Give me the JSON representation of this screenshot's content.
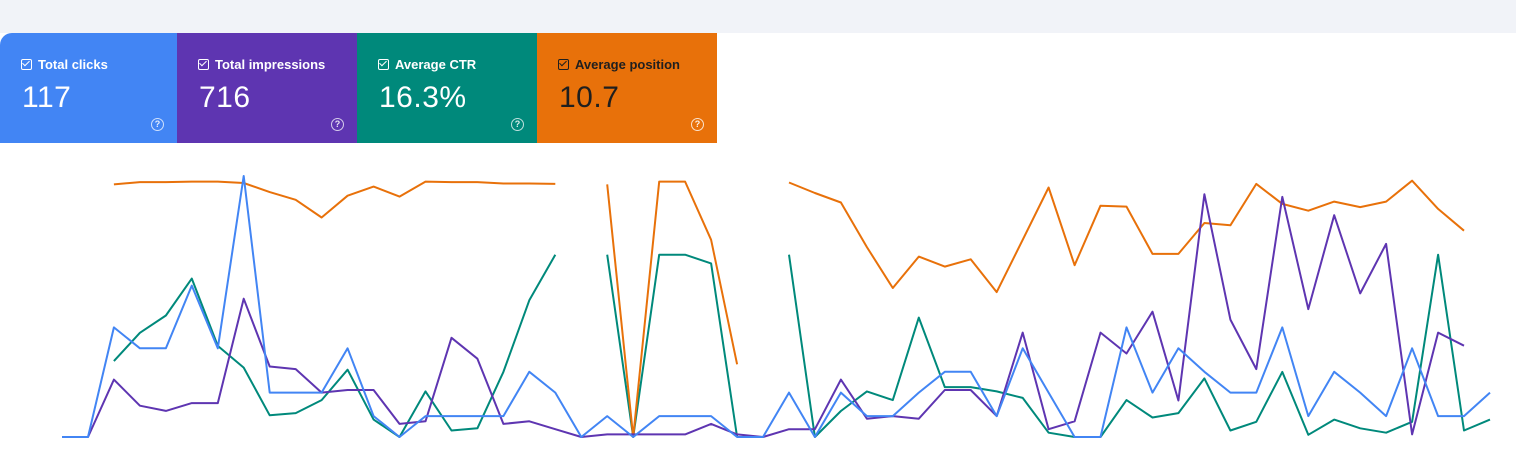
{
  "metrics": [
    {
      "label": "Total clicks",
      "value": "117",
      "color": "#4285f4",
      "checked": true
    },
    {
      "label": "Total impressions",
      "value": "716",
      "color": "#5e35b1",
      "checked": true
    },
    {
      "label": "Average CTR",
      "value": "16.3%",
      "color": "#00897b",
      "checked": true
    },
    {
      "label": "Average position",
      "value": "10.7",
      "color": "#e8710a",
      "checked": true
    }
  ],
  "chart_data": {
    "type": "line",
    "x": [
      1,
      2,
      3,
      4,
      5,
      6,
      7,
      8,
      9,
      10,
      11,
      12,
      13,
      14,
      15,
      16,
      17,
      18,
      19,
      20,
      21,
      22,
      23,
      24,
      25,
      26,
      27,
      28,
      29,
      30,
      31,
      32,
      33,
      34,
      35,
      36,
      37,
      38,
      39,
      40,
      41,
      42,
      43,
      44,
      45,
      46,
      47,
      48,
      49,
      50,
      51,
      52,
      53,
      54,
      55,
      56
    ],
    "series": [
      {
        "name": "Total clicks",
        "color": "#4285f4",
        "values": [
          0,
          0,
          0.42,
          0.34,
          0.34,
          0.58,
          0.34,
          1,
          0.17,
          0.17,
          0.17,
          0.34,
          0.08,
          0,
          0.08,
          0.08,
          0.08,
          0.08,
          0.25,
          0.17,
          0,
          0.08,
          0,
          0.08,
          0.08,
          0.08,
          0,
          0,
          0.17,
          0,
          0.17,
          0.08,
          0.08,
          0.17,
          0.25,
          0.25,
          0.08,
          0.34,
          0.17,
          0,
          0,
          0.42,
          0.17,
          0.34,
          0.25,
          0.17,
          0.17,
          0.42,
          0.08,
          0.25,
          0.17,
          0.08,
          0.34,
          0.08,
          0.08,
          0.17
        ]
      },
      {
        "name": "Total impressions",
        "color": "#5e35b1",
        "values": [
          0,
          0,
          0.22,
          0.12,
          0.1,
          0.13,
          0.13,
          0.53,
          0.27,
          0.26,
          0.17,
          0.18,
          0.18,
          0.05,
          0.06,
          0.38,
          0.3,
          0.05,
          0.06,
          0.03,
          0,
          0.01,
          0.01,
          0.01,
          0.01,
          0.05,
          0.01,
          0,
          0.03,
          0.03,
          0.22,
          0.07,
          0.08,
          0.07,
          0.18,
          0.18,
          0.08,
          0.4,
          0.03,
          0.06,
          0.4,
          0.32,
          0.48,
          0.14,
          0.93,
          0.45,
          0.26,
          0.92,
          0.49,
          0.85,
          0.55,
          0.74,
          0.01,
          0.4,
          0.35
        ]
      },
      {
        "name": "Average CTR",
        "color": "#00897b",
        "values": [
          null,
          null,
          0.35,
          0.48,
          0.56,
          0.73,
          0.42,
          0.32,
          0.1,
          0.11,
          0.17,
          0.31,
          0.08,
          0,
          0.21,
          0.03,
          0.04,
          0.3,
          0.63,
          0.84,
          null,
          0.84,
          0,
          0.84,
          0.84,
          0.8,
          0,
          null,
          0.84,
          0,
          0.12,
          0.21,
          0.17,
          0.55,
          0.23,
          0.23,
          0.21,
          0.18,
          0.02,
          0,
          0,
          0.17,
          0.09,
          0.11,
          0.27,
          0.03,
          0.07,
          0.3,
          0.01,
          0.08,
          0.04,
          0.02,
          0.07,
          0.84,
          0.03,
          0.08
        ]
      },
      {
        "name": "Average position",
        "color": "#e8710a",
        "values": [
          null,
          null,
          14.4,
          13.9,
          13.9,
          13.8,
          13.8,
          14.1,
          16.1,
          17.8,
          21.7,
          16.9,
          14.9,
          17.1,
          13.8,
          13.9,
          13.9,
          14.2,
          14.2,
          14.3,
          null,
          14.4,
          70,
          13.8,
          13.8,
          26.6,
          54,
          null,
          14,
          16.3,
          18.4,
          28.2,
          37.2,
          30.3,
          32.5,
          30.9,
          38.1,
          26.6,
          15.1,
          32.2,
          19.1,
          19.3,
          29.7,
          29.7,
          22.9,
          23.4,
          14.3,
          18.7,
          20.2,
          18.2,
          19.4,
          18.2,
          13.6,
          19.8,
          24.6
        ]
      }
    ],
    "position_ylim": [
      13,
      70
    ],
    "grid": false,
    "legend": "top-cards"
  }
}
